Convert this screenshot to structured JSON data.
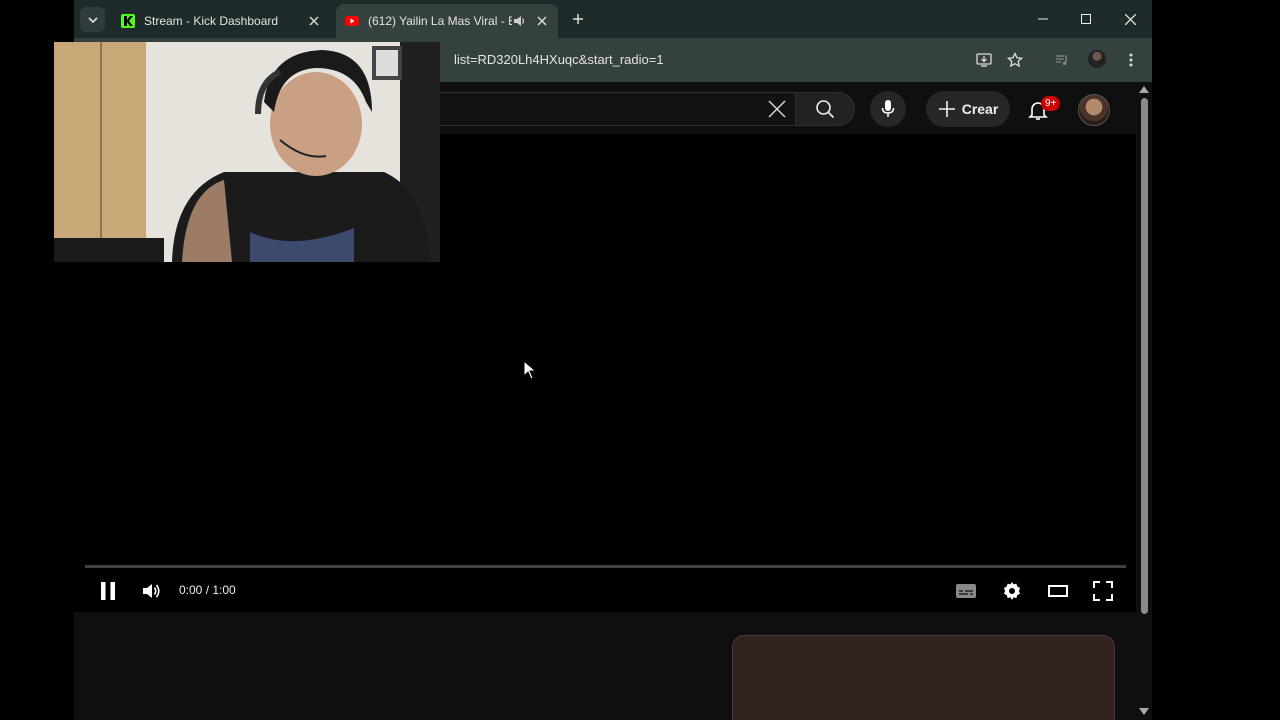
{
  "tabs": [
    {
      "title": "Stream - Kick Dashboard",
      "favicon": "kick-icon",
      "active": false
    },
    {
      "title": "(612) Yailin La Mas Viral - B",
      "favicon": "youtube-icon",
      "active": true,
      "audio": "speaker-icon"
    }
  ],
  "address_bar": {
    "url": "list=RD320Lh4HXuqc&start_radio=1"
  },
  "header": {
    "create_label": "Crear",
    "notification_badge": "9+"
  },
  "player": {
    "time": "0:00 / 1:00",
    "progress": 0
  },
  "colors": {
    "tabstrip": "#1f2b2b",
    "toolbar": "#35413f",
    "page_bg": "#0f0f0f",
    "progress_red": "#ff0000",
    "kick_green": "#53fc18",
    "youtube_red": "#ff0000",
    "badge_red": "#cc0000"
  }
}
